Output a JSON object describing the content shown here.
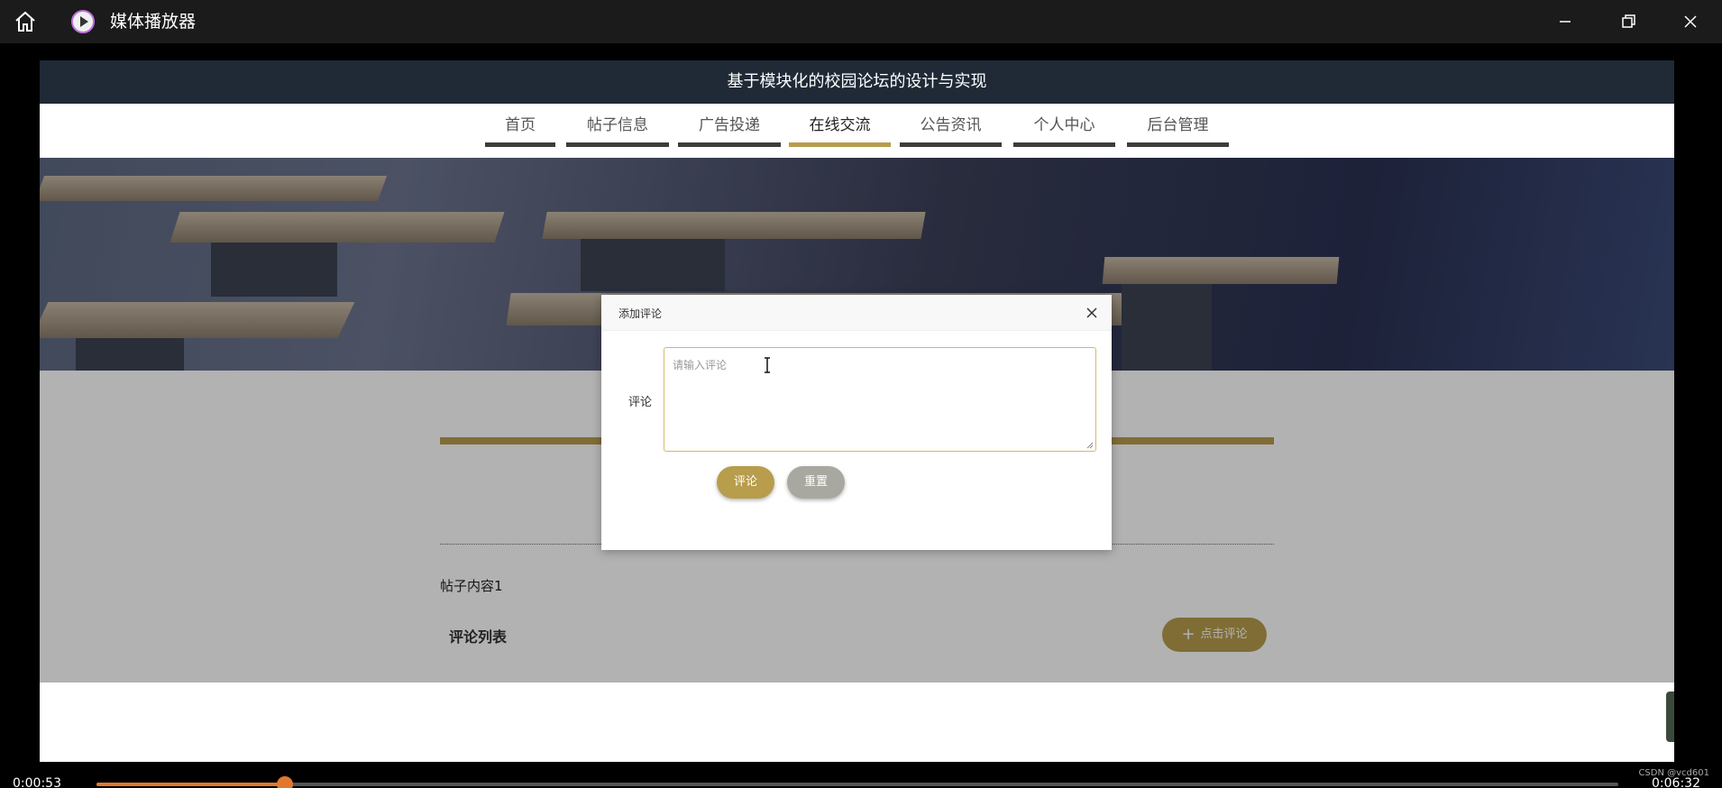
{
  "player": {
    "title": "媒体播放器",
    "current_time": "0:00:53",
    "total_time": "0:06:32",
    "progress": 0.124,
    "watermark": "CSDN @vcd601",
    "accent_color": "#e0782e"
  },
  "site": {
    "title": "基于模块化的校园论坛的设计与实现",
    "nav": [
      {
        "label": "首页"
      },
      {
        "label": "帖子信息"
      },
      {
        "label": "广告投递"
      },
      {
        "label": "在线交流"
      },
      {
        "label": "公告资讯"
      },
      {
        "label": "个人中心"
      },
      {
        "label": "后台管理"
      }
    ],
    "active_nav": "在线交流",
    "accent_color": "#b79d4c"
  },
  "page": {
    "post_content": "帖子内容1",
    "comment_list_title": "评论列表",
    "comment_button": "点击评论"
  },
  "dialog": {
    "title": "添加评论",
    "field_label": "评论",
    "placeholder": "请输入评论",
    "submit_label": "评论",
    "reset_label": "重置"
  }
}
